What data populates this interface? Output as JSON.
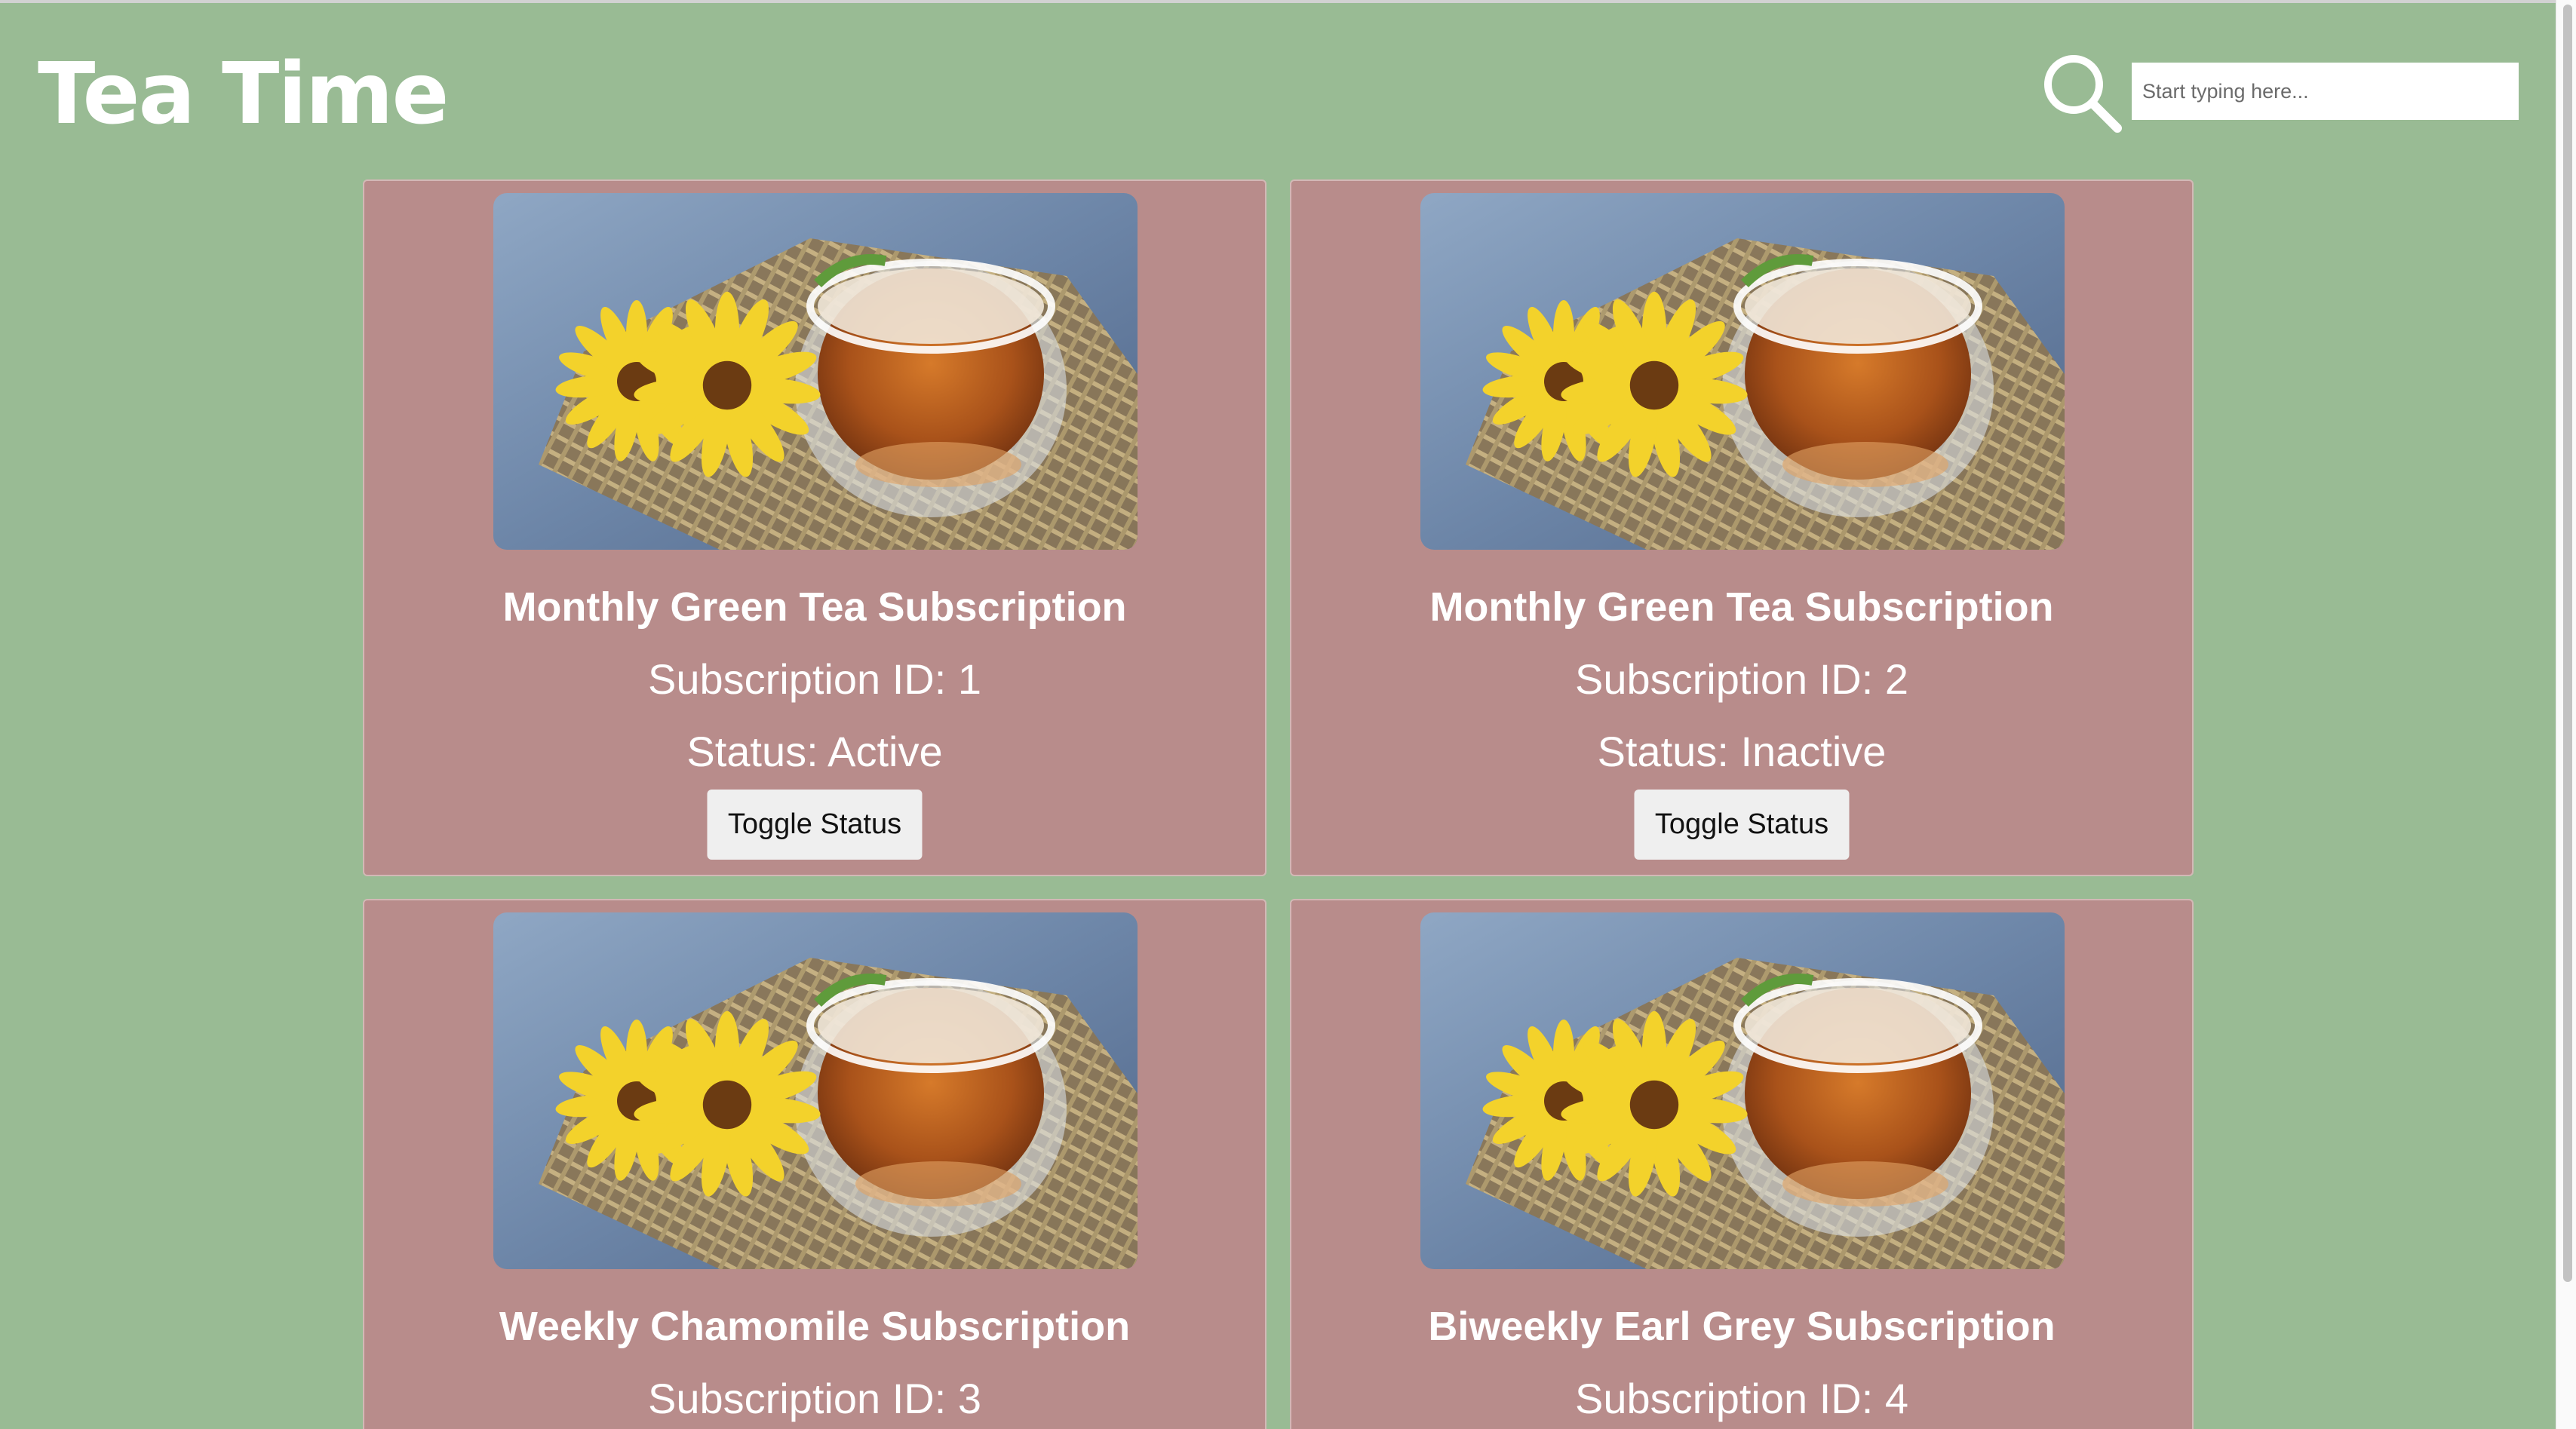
{
  "app": {
    "title": "Tea Time"
  },
  "search": {
    "placeholder": "Start typing here...",
    "icon": "search-icon"
  },
  "subscriptions": [
    {
      "title": "Monthly Green Tea Subscription",
      "id_label": "Subscription ID: 1",
      "status_label": "Status: Active",
      "button_label": "Toggle Status"
    },
    {
      "title": "Monthly Green Tea Subscription",
      "id_label": "Subscription ID: 2",
      "status_label": "Status: Inactive",
      "button_label": "Toggle Status"
    },
    {
      "title": "Weekly Chamomile Subscription",
      "id_label": "Subscription ID: 3",
      "status_label": "",
      "button_label": ""
    },
    {
      "title": "Biweekly Earl Grey Subscription",
      "id_label": "Subscription ID: 4",
      "status_label": "",
      "button_label": ""
    }
  ],
  "colors": {
    "background": "#99bb94",
    "card": "#b88c8b",
    "button": "#efefef",
    "text": "#ffffff"
  }
}
